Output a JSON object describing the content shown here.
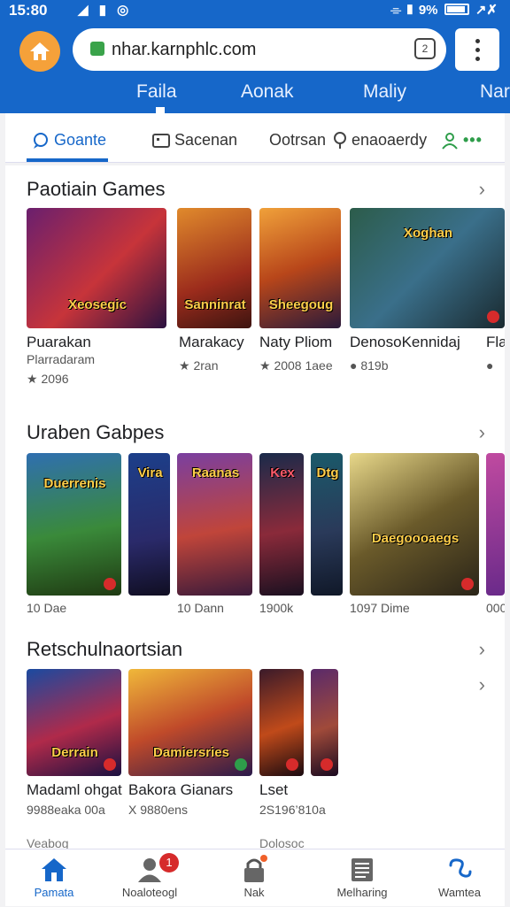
{
  "status": {
    "time": "15:80",
    "battery": "9%",
    "extra": "↗✗"
  },
  "browser": {
    "url": "nhar.karnphlc.com",
    "tab_count": "2",
    "nav_tabs": [
      "Faila",
      "Aonak",
      "Maliy",
      "Nar"
    ]
  },
  "filters": [
    "Goante",
    "Sacenan",
    "Ootrsan",
    "enaoaerdy"
  ],
  "sections": [
    {
      "title": "Paotiain Games",
      "items": [
        {
          "name": "Puarakan",
          "dev": "Plarradaram",
          "rating": "2096",
          "art": "Xeosegic"
        },
        {
          "name": "Marakacy",
          "dev": "",
          "rating": "2ran",
          "art": "Sanninrat"
        },
        {
          "name": "Naty Pliom",
          "dev": "",
          "rating": "2008 1aee",
          "art": "Sheegoug"
        },
        {
          "name": "DenosoKennidaj",
          "dev": "",
          "rating": "819b",
          "art": "Xoghan"
        },
        {
          "name": "Fla",
          "dev": "",
          "rating": "",
          "art": ""
        }
      ]
    },
    {
      "title": "Uraben Gabpes",
      "items": [
        {
          "meta": "10 Dae",
          "art": "Duerrenis"
        },
        {
          "meta": "",
          "art": "Vira"
        },
        {
          "meta": "10 Dann",
          "art": "Raanas"
        },
        {
          "meta": "1900k",
          "art": "Kex"
        },
        {
          "meta": "",
          "art": "Dtg"
        },
        {
          "meta": "1097 Dime",
          "art": "Daegoooaegs"
        },
        {
          "meta": "000",
          "art": ""
        }
      ]
    },
    {
      "title": "Retschulnaortsian",
      "items": [
        {
          "name": "Madaml ohgat",
          "meta": "9988eaka 00a",
          "art": "Derrain"
        },
        {
          "name": "Bakora Gianars",
          "meta": "X 9880ens",
          "art": "Damiersries"
        },
        {
          "name": "Lset",
          "meta": "2S196’810a",
          "art": ""
        },
        {
          "name": "",
          "meta": "",
          "art": ""
        }
      ]
    }
  ],
  "peek": [
    "Veabog",
    "Dolosoc"
  ],
  "bottom_nav": [
    {
      "label": "Pamata",
      "icon": "home-icon"
    },
    {
      "label": "Noaloteogl",
      "icon": "person-icon",
      "count": "1"
    },
    {
      "label": "Nak",
      "icon": "lock-icon"
    },
    {
      "label": "Melharing",
      "icon": "book-icon"
    },
    {
      "label": "Wamtea",
      "icon": "swirl-icon"
    }
  ],
  "colors": {
    "primary": "#1667c9",
    "accent": "#f5a13a",
    "alert": "#d62b2b"
  }
}
